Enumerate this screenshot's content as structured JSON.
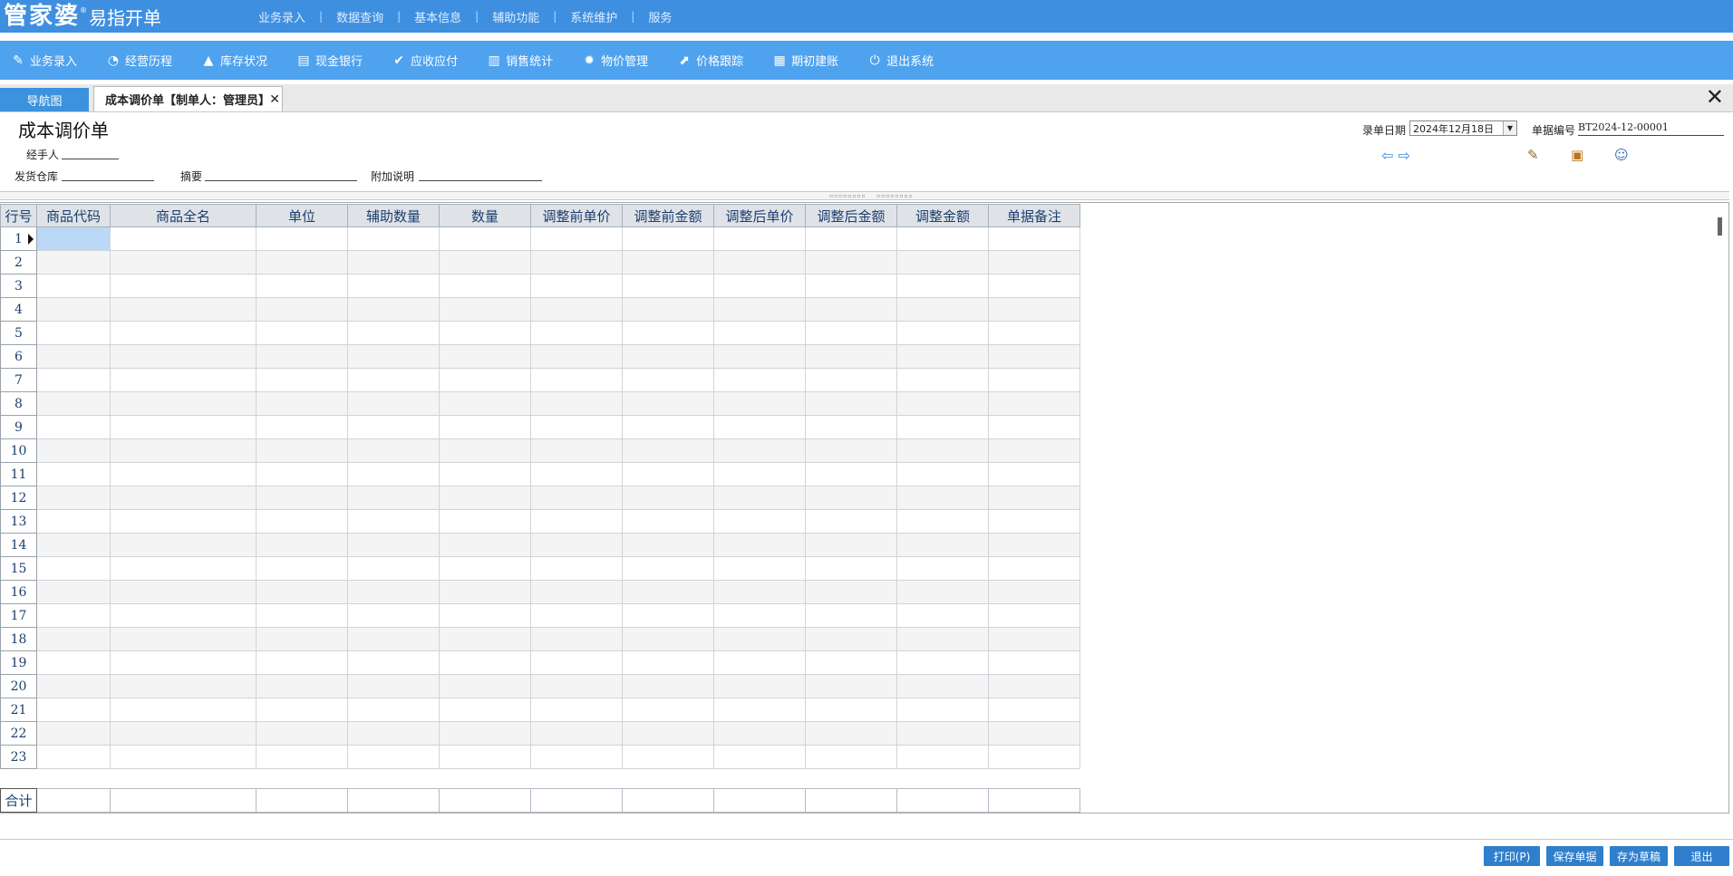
{
  "app": {
    "logo_main": "管家婆",
    "logo_reg": "®",
    "logo_sub": "易指开单"
  },
  "top_menu": [
    "业务录入",
    "数据查询",
    "基本信息",
    "辅助功能",
    "系统维护",
    "服务"
  ],
  "top_menu_sep": "|",
  "toolbar": [
    {
      "label": "业务录入",
      "icon": "pencil-icon",
      "glyph": "✎"
    },
    {
      "label": "经营历程",
      "icon": "pie-chart-icon",
      "glyph": "◔"
    },
    {
      "label": "库存状况",
      "icon": "flame-icon",
      "glyph": "▲"
    },
    {
      "label": "现金银行",
      "icon": "document-icon",
      "glyph": "▤"
    },
    {
      "label": "应收应付",
      "icon": "check-circle-icon",
      "glyph": "✔"
    },
    {
      "label": "销售统计",
      "icon": "bar-chart-icon",
      "glyph": "▥"
    },
    {
      "label": "物价管理",
      "icon": "gear-icon",
      "glyph": "✹"
    },
    {
      "label": "价格跟踪",
      "icon": "arrow-up-right-icon",
      "glyph": "⬈"
    },
    {
      "label": "期初建账",
      "icon": "calendar-icon",
      "glyph": "▦"
    },
    {
      "label": "退出系统",
      "icon": "power-icon",
      "glyph": "⏻"
    }
  ],
  "tabs": {
    "nav": "导航图",
    "active": "成本调价单【制单人：管理员】",
    "close_glyph": "✕",
    "window_close_glyph": "✕"
  },
  "form": {
    "title": "成本调价单",
    "handler_label": "经手人",
    "warehouse_label": "发货仓库",
    "summary_label": "摘要",
    "note_label": "附加说明",
    "date_label": "录单日期",
    "date_value": "2024年12月18日",
    "docno_label": "单据编号",
    "docno_value": "BT2024-12-00001"
  },
  "nav_arrows": {
    "prev": "⇦",
    "next": "⇨"
  },
  "header_icons": [
    {
      "name": "edit-note-icon",
      "glyph": "✎"
    },
    {
      "name": "package-icon",
      "glyph": "▣"
    },
    {
      "name": "user-icon",
      "glyph": "☺"
    }
  ],
  "grid": {
    "columns": [
      "行号",
      "商品代码",
      "商品全名",
      "单位",
      "辅助数量",
      "数量",
      "调整前单价",
      "调整前金额",
      "调整后单价",
      "调整后金额",
      "调整金额",
      "单据备注"
    ],
    "rows": [
      "1",
      "2",
      "3",
      "4",
      "5",
      "6",
      "7",
      "8",
      "9",
      "10",
      "11",
      "12",
      "13",
      "14",
      "15",
      "16",
      "17",
      "18",
      "19",
      "20",
      "21",
      "22",
      "23"
    ],
    "total_label": "合计"
  },
  "footer": {
    "print": "打印(P)",
    "save": "保存单据",
    "draft": "存为草稿",
    "exit": "退出"
  }
}
